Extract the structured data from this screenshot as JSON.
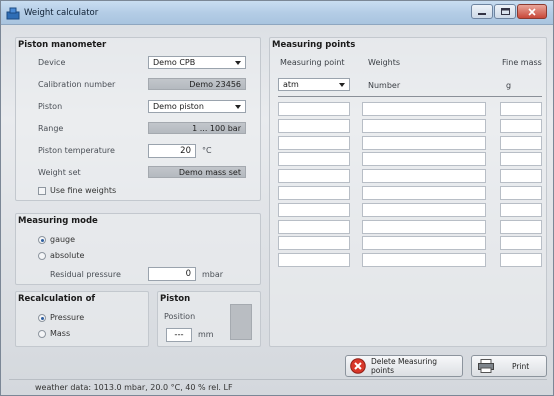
{
  "window": {
    "title": "Weight calculator"
  },
  "manometer": {
    "title": "Piston manometer",
    "device_label": "Device",
    "device_value": "Demo CPB",
    "calib_label": "Calibration number",
    "calib_value": "Demo 23456",
    "piston_label": "Piston",
    "piston_value": "Demo piston",
    "range_label": "Range",
    "range_value": "1 ... 100 bar",
    "temp_label": "Piston temperature",
    "temp_value": "20",
    "temp_unit": "°C",
    "weightset_label": "Weight set",
    "weightset_value": "Demo mass set",
    "finew_label": "Use fine weights",
    "finew_checked": false
  },
  "mode": {
    "title": "Measuring mode",
    "gauge_label": "gauge",
    "absolute_label": "absolute",
    "selected": "gauge",
    "residual_label": "Residual pressure",
    "residual_value": "0",
    "residual_unit": "mbar"
  },
  "recalc": {
    "title": "Recalculation of",
    "pressure_label": "Pressure",
    "mass_label": "Mass",
    "selected": "Pressure"
  },
  "piston_pos": {
    "title": "Piston",
    "position_label": "Position",
    "value": "---",
    "unit": "mm"
  },
  "points": {
    "title": "Measuring points",
    "col_point": "Measuring point",
    "col_weights": "Weights",
    "col_fine": "Fine mass",
    "unit_select": "atm",
    "weights_sub": "Number",
    "fine_sub": "g",
    "rows": [
      "",
      "",
      "",
      "",
      "",
      "",
      "",
      "",
      "",
      ""
    ]
  },
  "actions": {
    "delete_label": "Delete Measuring points",
    "print_label": "Print"
  },
  "status": {
    "text": "weather data: 1013.0 mbar, 20.0 °C, 40 % rel. LF"
  }
}
